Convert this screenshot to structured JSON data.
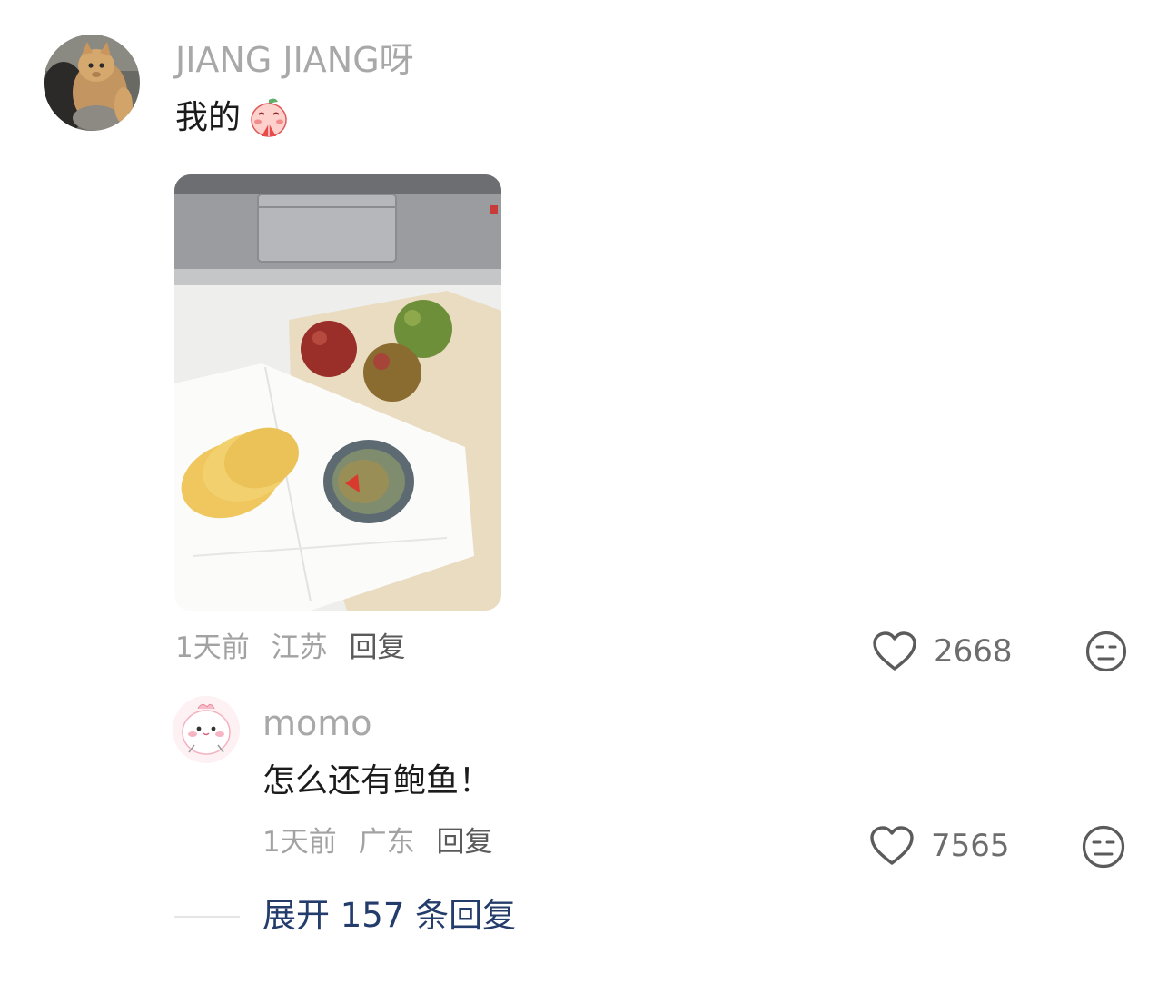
{
  "comment": {
    "username": "JIANG JIANG呀",
    "text": "我的",
    "emoji": "pray-blush-emoji",
    "image": "photo-lychees-chips-abalone",
    "meta": {
      "time": "1天前",
      "location": "江苏",
      "reply": "回复"
    },
    "likes": "2668"
  },
  "reply": {
    "username": "momo",
    "text": "怎么还有鲍鱼！",
    "meta": {
      "time": "1天前",
      "location": "广东",
      "reply": "回复"
    },
    "likes": "7565"
  },
  "expand": {
    "label": "展开 157 条回复"
  },
  "icons": {
    "like": "heart-outline-icon",
    "dislike": "meh-face-icon"
  }
}
